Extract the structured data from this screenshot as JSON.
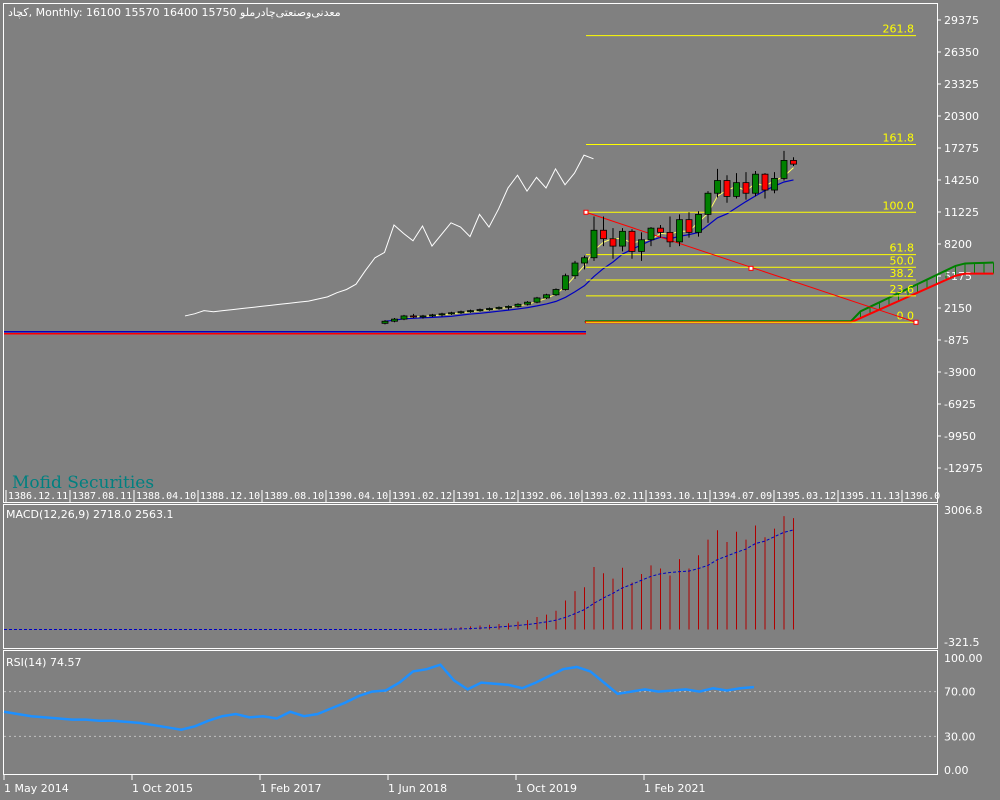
{
  "header": {
    "symbol": "کچاد",
    "timeframe": "Monthly",
    "ohlc": [
      "16100",
      "15570",
      "16400",
      "15750"
    ],
    "description": "معدنی‌وصنعتی‌چادرملو"
  },
  "watermark": "Mofid Securities",
  "colors": {
    "background": "#808080",
    "bull_candle": "#008000",
    "bear_candle": "#ff0000",
    "fib": "#ffff00",
    "trend_line": "#ff0000",
    "macd_hist": "#b00000",
    "macd_signal": "#0000c0",
    "rsi": "#1e90ff"
  },
  "price_axis_labels": [
    "29375",
    "26350",
    "23325",
    "20300",
    "17275",
    "14250",
    "11225",
    "8200",
    "5175",
    "2150",
    "-875",
    "-3900",
    "-6925",
    "-9950",
    "-12975"
  ],
  "persian_date_labels": [
    "1386.12.11",
    "1387.08.11",
    "1388.04.10",
    "1388.12.10",
    "1389.08.10",
    "1390.04.10",
    "1391.02.12",
    "1391.10.12",
    "1392.06.10",
    "1393.02.11",
    "1393.10.11",
    "1394.07.09",
    "1395.03.12",
    "1395.11.13",
    "1396.0"
  ],
  "gregorian_date_labels": [
    "1 May 2014",
    "1 Oct 2015",
    "1 Feb 2017",
    "1 Jun 2018",
    "1 Oct 2019",
    "1 Feb 2021"
  ],
  "macd": {
    "label": "MACD(12,26,9) 2718.0 2563.1",
    "axis_labels": [
      "3006.8",
      "-321.5"
    ]
  },
  "rsi": {
    "label": "RSI(14) 74.57",
    "axis_labels": [
      "100.00",
      "70.00",
      "30.00",
      "0.00"
    ]
  },
  "chart_data": [
    {
      "type": "candlestick",
      "title": "کچاد, Monthly: 16100 15570 16400 15750",
      "ylim": [
        -14500,
        31000
      ],
      "y_ticks": [
        29375,
        26350,
        23325,
        20300,
        17275,
        14250,
        11225,
        8200,
        5175,
        2150,
        -875,
        -3900,
        -6925,
        -9950,
        -12975
      ],
      "fibonacci": {
        "levels": [
          {
            "label": "261.8",
            "price": 27900
          },
          {
            "label": "161.8",
            "price": 17600
          },
          {
            "label": "100.0",
            "price": 11200
          },
          {
            "label": "61.8",
            "price": 7200
          },
          {
            "label": "50.0",
            "price": 6000
          },
          {
            "label": "38.2",
            "price": 4800
          },
          {
            "label": "23.6",
            "price": 3300
          },
          {
            "label": "0.0",
            "price": 800
          }
        ]
      },
      "candles": [
        {
          "o": 700,
          "h": 1000,
          "l": 600,
          "c": 900
        },
        {
          "o": 900,
          "h": 1200,
          "l": 800,
          "c": 1100
        },
        {
          "o": 1100,
          "h": 1500,
          "l": 1000,
          "c": 1400
        },
        {
          "o": 1400,
          "h": 1600,
          "l": 1200,
          "c": 1300
        },
        {
          "o": 1300,
          "h": 1500,
          "l": 1150,
          "c": 1400
        },
        {
          "o": 1400,
          "h": 1600,
          "l": 1300,
          "c": 1500
        },
        {
          "o": 1500,
          "h": 1700,
          "l": 1350,
          "c": 1600
        },
        {
          "o": 1600,
          "h": 1800,
          "l": 1500,
          "c": 1700
        },
        {
          "o": 1700,
          "h": 1900,
          "l": 1600,
          "c": 1800
        },
        {
          "o": 1800,
          "h": 2000,
          "l": 1700,
          "c": 1900
        },
        {
          "o": 1900,
          "h": 2100,
          "l": 1800,
          "c": 2000
        },
        {
          "o": 2000,
          "h": 2200,
          "l": 1900,
          "c": 2100
        },
        {
          "o": 2100,
          "h": 2300,
          "l": 2000,
          "c": 2200
        },
        {
          "o": 2200,
          "h": 2400,
          "l": 2000,
          "c": 2300
        },
        {
          "o": 2300,
          "h": 2600,
          "l": 2200,
          "c": 2500
        },
        {
          "o": 2500,
          "h": 2800,
          "l": 2400,
          "c": 2700
        },
        {
          "o": 2700,
          "h": 3200,
          "l": 2600,
          "c": 3100
        },
        {
          "o": 3100,
          "h": 3500,
          "l": 3000,
          "c": 3400
        },
        {
          "o": 3400,
          "h": 4000,
          "l": 3300,
          "c": 3900
        },
        {
          "o": 3900,
          "h": 5400,
          "l": 3800,
          "c": 5200
        },
        {
          "o": 5200,
          "h": 6600,
          "l": 4900,
          "c": 6400
        },
        {
          "o": 6400,
          "h": 7100,
          "l": 5800,
          "c": 6900
        },
        {
          "o": 6900,
          "h": 10800,
          "l": 6600,
          "c": 9500
        },
        {
          "o": 9500,
          "h": 10800,
          "l": 8000,
          "c": 8700
        },
        {
          "o": 8700,
          "h": 9700,
          "l": 6800,
          "c": 8000
        },
        {
          "o": 8000,
          "h": 9700,
          "l": 7500,
          "c": 9400
        },
        {
          "o": 9400,
          "h": 9600,
          "l": 6800,
          "c": 7500
        },
        {
          "o": 7500,
          "h": 9300,
          "l": 6600,
          "c": 8600
        },
        {
          "o": 8600,
          "h": 9800,
          "l": 8000,
          "c": 9700
        },
        {
          "o": 9700,
          "h": 10000,
          "l": 8800,
          "c": 9300
        },
        {
          "o": 9300,
          "h": 10800,
          "l": 7900,
          "c": 8400
        },
        {
          "o": 8400,
          "h": 11000,
          "l": 8000,
          "c": 10500
        },
        {
          "o": 10500,
          "h": 11200,
          "l": 8800,
          "c": 9300
        },
        {
          "o": 9300,
          "h": 11300,
          "l": 8900,
          "c": 11000
        },
        {
          "o": 11000,
          "h": 13200,
          "l": 10200,
          "c": 13000
        },
        {
          "o": 13000,
          "h": 15300,
          "l": 12600,
          "c": 14200
        },
        {
          "o": 14200,
          "h": 14700,
          "l": 12100,
          "c": 12700
        },
        {
          "o": 12700,
          "h": 14900,
          "l": 12500,
          "c": 14000
        },
        {
          "o": 14000,
          "h": 15000,
          "l": 12400,
          "c": 13000
        },
        {
          "o": 13000,
          "h": 15100,
          "l": 12700,
          "c": 14800
        },
        {
          "o": 14800,
          "h": 14900,
          "l": 12500,
          "c": 13300
        },
        {
          "o": 13300,
          "h": 15000,
          "l": 13000,
          "c": 14400
        },
        {
          "o": 14400,
          "h": 17000,
          "l": 14200,
          "c": 16100
        },
        {
          "o": 16100,
          "h": 16400,
          "l": 15570,
          "c": 15750
        }
      ]
    },
    {
      "type": "bar",
      "title": "MACD(12,26,9) 2718.0 2563.1",
      "ylim": [
        -321.5,
        3006.8
      ]
    },
    {
      "type": "line",
      "title": "RSI(14) 74.57",
      "ylim": [
        0,
        100
      ]
    }
  ]
}
